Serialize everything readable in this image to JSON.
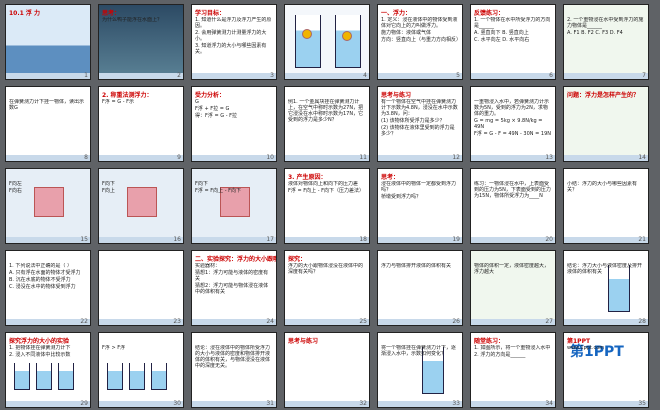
{
  "window": {
    "title": "Slide sorter"
  },
  "colors": {
    "background": "#5f6266",
    "slide_border": "#222222",
    "title_red": "#cc0000",
    "water": "#9bd1f0"
  },
  "slides": [
    {
      "num": "1",
      "title": "10.1 浮 力",
      "body": []
    },
    {
      "num": "2",
      "title": "思考：",
      "body": [
        "为什么鸭子能浮在水面上？"
      ]
    },
    {
      "num": "3",
      "title": "学习目标：",
      "body": [
        "1. 知道什么是浮力及浮力产生的原因。",
        "2. 会用弹簧测力计测量浮力的大小。",
        "3. 知道浮力的大小与哪些因素有关。"
      ]
    },
    {
      "num": "4",
      "title": "",
      "body": []
    },
    {
      "num": "5",
      "title": "一、浮力：",
      "body": [
        "1. 定义：浸在液体中的物体受到液体对它向上的力叫做浮力。",
        "施力物体：液体或气体",
        "方向：竖直向上（与重力方向相反）"
      ]
    },
    {
      "num": "6",
      "title": "反馈练习：",
      "body": [
        "1. 一个物体在水中所受浮力的方向是______",
        "A. 竖直向下  B. 竖直向上",
        "C. 水平向左  D. 水平向右"
      ]
    },
    {
      "num": "7",
      "title": "",
      "body": [
        "2. 一个重物浸在水中受到浮力的施力物体是______",
        "A. F1  B. F2  C. F3  D. F4"
      ]
    },
    {
      "num": "8",
      "title": "",
      "body": [
        "在弹簧测力计下挂一物体，读出示数G"
      ]
    },
    {
      "num": "9",
      "title": "2. 称重法测浮力：",
      "body": [
        "F浮 = G - F示"
      ]
    },
    {
      "num": "10",
      "title": "受力分析：",
      "body": [
        "G",
        "F浮 + F拉 = G",
        "得：F浮 = G - F拉"
      ]
    },
    {
      "num": "11",
      "title": "",
      "body": [
        "例1. 一个金属块挂在弹簧测力计上，在空气中称时示数为27N，把它浸没在水中称时示数为17N，它受到的浮力是多少N？"
      ]
    },
    {
      "num": "12",
      "title": "思考与练习",
      "body": [
        "有一个物体在空气中挂在弹簧测力计下示数为4.8N，浸没在水中示数为3.8N，问：",
        "(1) 该物体所受浮力是多少？",
        "(2) 该物体在液体里受到的浮力是多少？"
      ]
    },
    {
      "num": "13",
      "title": "",
      "body": [
        "一重物浸入水中，若弹簧测力计示数为5N，受到的浮力为2N，求物体的重力。",
        "G = mg = 5kg × 9.8N/kg = 49N",
        "F浮 = G - F = 49N - 30N = 19N"
      ]
    },
    {
      "num": "14",
      "title": "问题：浮力是怎样产生的？",
      "body": []
    },
    {
      "num": "15",
      "title": "",
      "body": [
        "F向左",
        "F向右"
      ]
    },
    {
      "num": "16",
      "title": "",
      "body": [
        "F向下",
        "F向上"
      ]
    },
    {
      "num": "17",
      "title": "",
      "body": [
        "F向下",
        "F浮 = F向上 - F向下"
      ]
    },
    {
      "num": "18",
      "title": "3. 产生原因：",
      "body": [
        "液体对物体向上和向下的压力差",
        "F浮 = F向上 - F向下（压力差法）"
      ]
    },
    {
      "num": "19",
      "title": "思考：",
      "body": [
        "浸在液体中的物体一定都受到浮力吗？",
        "桥墩受到浮力吗？"
      ]
    },
    {
      "num": "20",
      "title": "",
      "body": [
        "练习：一物体浸在水中，上表面受到的压力为5N，下表面受到的压力为15N，物体所受浮力为____N"
      ]
    },
    {
      "num": "21",
      "title": "",
      "body": [
        "小结：浮力的大小与哪些因素有关？"
      ]
    },
    {
      "num": "22",
      "title": "",
      "body": [
        "1. 下列说法中正确的是（ ）",
        "A. 只有浮在水面的物体才受浮力",
        "B. 沉在水底的物体不受浮力",
        "C. 浸没在水中的物体受到浮力"
      ]
    },
    {
      "num": "23",
      "title": "",
      "body": []
    },
    {
      "num": "24",
      "title": "二、实验探究：浮力的大小跟哪些因素有关",
      "body": [
        "实验器材：",
        "猜想1：浮力可能与液体的密度有关",
        "猜想2：浮力可能与物体浸在液体中的体积有关"
      ]
    },
    {
      "num": "25",
      "title": "探究：",
      "body": [
        "浮力的大小跟物体浸没在液体中的深度有关吗？"
      ]
    },
    {
      "num": "26",
      "title": "",
      "body": [
        "浮力与物体排开液体的体积有关"
      ]
    },
    {
      "num": "27",
      "title": "",
      "body": [
        "物体的体积一定，液体密度越大，浮力越大"
      ]
    },
    {
      "num": "28",
      "title": "",
      "body": [
        "结论：浮力大小与液体密度及排开液体的体积有关"
      ]
    },
    {
      "num": "29",
      "title": "探究浮力的大小的实验",
      "body": [
        "1. 把物体挂在弹簧测力计下",
        "2. 浸入不同液体中比较示数"
      ]
    },
    {
      "num": "30",
      "title": "",
      "body": [
        "F浮 > F浮"
      ]
    },
    {
      "num": "31",
      "title": "",
      "body": [
        "结论：浸在液体中的物体所受浮力的大小与液体的密度和物体排开液体的体积有关，与物体浸没在液体中的深度无关。"
      ]
    },
    {
      "num": "32",
      "title": "思考与练习",
      "body": []
    },
    {
      "num": "33",
      "title": "",
      "body": [
        "将一个物体挂在弹簧测力计下，逐渐浸入水中，示数如何变化？"
      ]
    },
    {
      "num": "34",
      "title": "随堂练习：",
      "body": [
        "1. 如图所示，将一个重物浸入水中",
        "2. 浮力的方向是______"
      ]
    },
    {
      "num": "35",
      "title": "第1PPT",
      "body": [
        "www.1ppt.com"
      ]
    }
  ]
}
